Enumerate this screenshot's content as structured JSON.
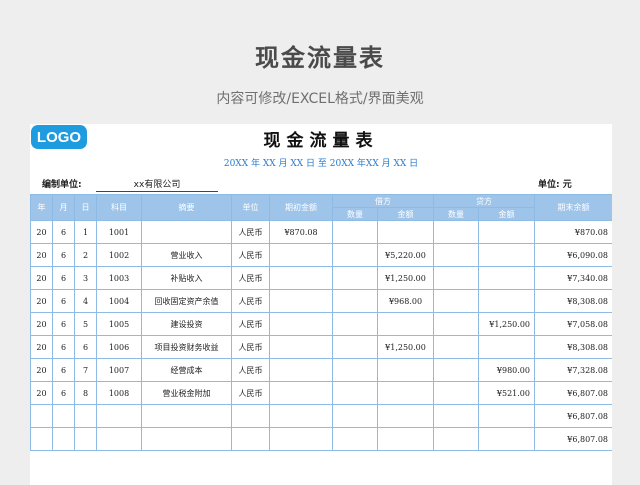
{
  "page": {
    "title": "现金流量表",
    "subtitle": "内容可修改/EXCEL格式/界面美观"
  },
  "sheet": {
    "logo": "LOGO",
    "title": "现金流量表",
    "date_line": "20XX 年 XX 月 XX 日 至 20XX 年XX 月 XX 日",
    "unit_label": "编制单位:",
    "company": "xx有限公司",
    "unit_right": "单位: 元"
  },
  "table": {
    "headers": {
      "year": "年",
      "month": "月",
      "day": "日",
      "subject": "科目",
      "summary": "摘要",
      "unit": "单位",
      "opening": "期初金额",
      "debit": "借方",
      "credit": "贷方",
      "qty": "数量",
      "amount": "金额",
      "closing": "期末余额"
    },
    "rows": [
      {
        "y": "20",
        "m": "6",
        "d": "1",
        "subject": "1001",
        "summary": "",
        "unit": "人民币",
        "opening": "¥870.08",
        "dq": "",
        "da": "",
        "cq": "",
        "ca": "",
        "closing": "¥870.08"
      },
      {
        "y": "20",
        "m": "6",
        "d": "2",
        "subject": "1002",
        "summary": "营业收入",
        "unit": "人民币",
        "opening": "",
        "dq": "",
        "da": "¥5,220.00",
        "cq": "",
        "ca": "",
        "closing": "¥6,090.08"
      },
      {
        "y": "20",
        "m": "6",
        "d": "3",
        "subject": "1003",
        "summary": "补贴收入",
        "unit": "人民币",
        "opening": "",
        "dq": "",
        "da": "¥1,250.00",
        "cq": "",
        "ca": "",
        "closing": "¥7,340.08"
      },
      {
        "y": "20",
        "m": "6",
        "d": "4",
        "subject": "1004",
        "summary": "回收固定资产余值",
        "unit": "人民币",
        "opening": "",
        "dq": "",
        "da": "¥968.00",
        "cq": "",
        "ca": "",
        "closing": "¥8,308.08"
      },
      {
        "y": "20",
        "m": "6",
        "d": "5",
        "subject": "1005",
        "summary": "建设投资",
        "unit": "人民币",
        "opening": "",
        "dq": "",
        "da": "",
        "cq": "",
        "ca": "¥1,250.00",
        "closing": "¥7,058.08"
      },
      {
        "y": "20",
        "m": "6",
        "d": "6",
        "subject": "1006",
        "summary": "项目投资财务收益",
        "unit": "人民币",
        "opening": "",
        "dq": "",
        "da": "¥1,250.00",
        "cq": "",
        "ca": "",
        "closing": "¥8,308.08"
      },
      {
        "y": "20",
        "m": "6",
        "d": "7",
        "subject": "1007",
        "summary": "经营成本",
        "unit": "人民币",
        "opening": "",
        "dq": "",
        "da": "",
        "cq": "",
        "ca": "¥980.00",
        "closing": "¥7,328.08"
      },
      {
        "y": "20",
        "m": "6",
        "d": "8",
        "subject": "1008",
        "summary": "营业税金附加",
        "unit": "人民币",
        "opening": "",
        "dq": "",
        "da": "",
        "cq": "",
        "ca": "¥521.00",
        "closing": "¥6,807.08"
      },
      {
        "y": "",
        "m": "",
        "d": "",
        "subject": "",
        "summary": "",
        "unit": "",
        "opening": "",
        "dq": "",
        "da": "",
        "cq": "",
        "ca": "",
        "closing": "¥6,807.08"
      },
      {
        "y": "",
        "m": "",
        "d": "",
        "subject": "",
        "summary": "",
        "unit": "",
        "opening": "",
        "dq": "",
        "da": "",
        "cq": "",
        "ca": "",
        "closing": "¥6,807.08"
      }
    ]
  },
  "colors": {
    "background": "#eeeeee",
    "header_fill": "#9ec4ea",
    "grid": "#8dbbe6",
    "logo": "#1f9be0",
    "date_text": "#2a7bd0"
  }
}
